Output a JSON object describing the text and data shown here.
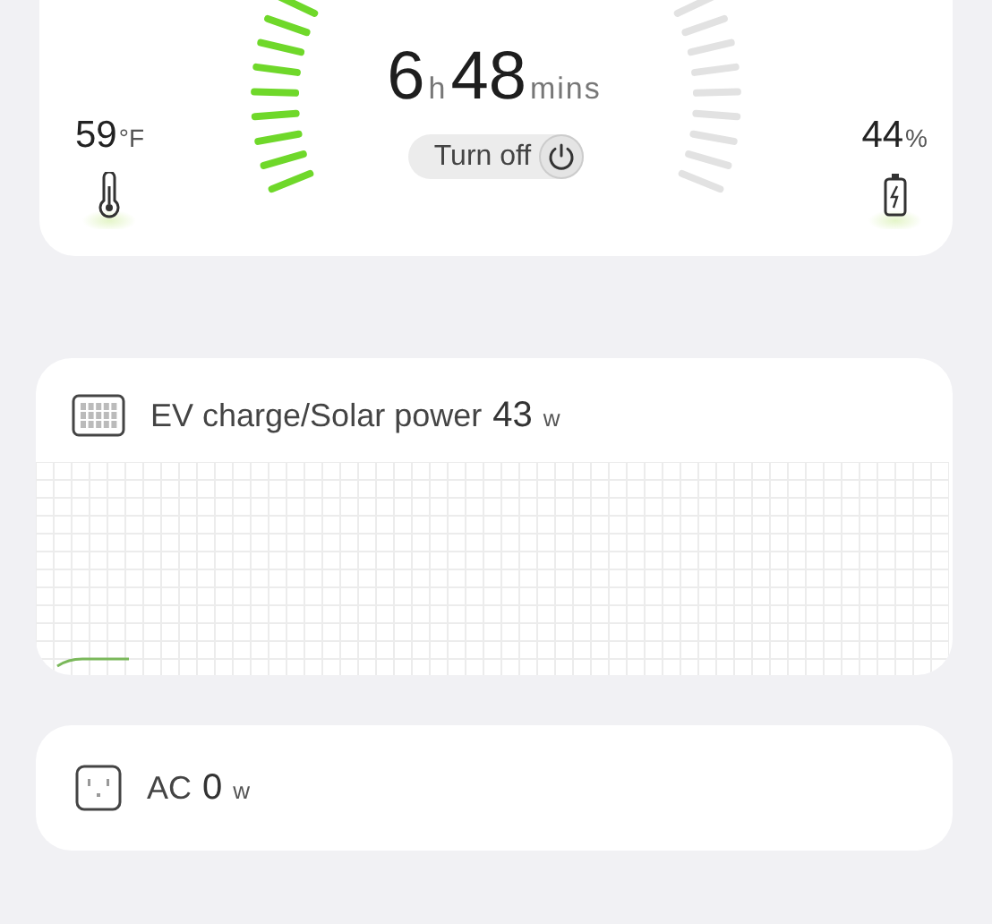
{
  "temperature": {
    "value": "59",
    "unit": "°F"
  },
  "battery": {
    "value": "44",
    "unit": "%"
  },
  "gauge": {
    "level": 0.5
  },
  "runtime": {
    "hours": "6",
    "hours_unit": "h",
    "minutes": "48",
    "minutes_unit": "mins"
  },
  "turn_off_button": {
    "label": "Turn off"
  },
  "solar_card": {
    "title": "EV charge/Solar power",
    "value": "43",
    "unit": "w"
  },
  "ac_card": {
    "title": "AC",
    "value": "0",
    "unit": "w"
  }
}
